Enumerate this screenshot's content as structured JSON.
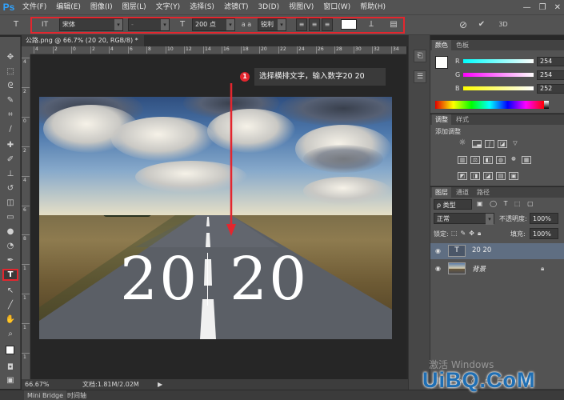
{
  "app": {
    "logo": "Ps",
    "menu": [
      "文件(F)",
      "编辑(E)",
      "图像(I)",
      "图层(L)",
      "文字(Y)",
      "选择(S)",
      "滤镜(T)",
      "3D(D)",
      "视图(V)",
      "窗口(W)",
      "帮助(H)"
    ],
    "window_controls": [
      "—",
      "❐",
      "✕"
    ]
  },
  "options_bar": {
    "tool_icon": "T",
    "orientation_icon": "IT",
    "font_family": "宋体",
    "font_style": "-",
    "font_size": "200 点",
    "aa_label": "a a",
    "aa_method": "锐利",
    "color_swatch": "#ffffff",
    "cancel_icon": "⊘",
    "commit_icon": "✔",
    "threed_label": "3D"
  },
  "document": {
    "tab_title": "公路.png @ 66.7% (20 20, RGB/8) *",
    "close_glyph": "×",
    "ruler_h_labels": [
      "4",
      "2",
      "0",
      "2",
      "4",
      "6",
      "8",
      "10",
      "12",
      "14",
      "16",
      "18",
      "20",
      "22",
      "24",
      "26",
      "28",
      "30",
      "32",
      "34"
    ],
    "ruler_v_labels": [
      "4",
      "2",
      "0",
      "2",
      "4",
      "6",
      "8",
      "1",
      "1",
      "1",
      "1"
    ],
    "canvas_text": "20 20",
    "canvas_text_left": "20",
    "canvas_text_right": "20"
  },
  "annotation": {
    "number": "1",
    "text": "选择横排文字，输入数字20 20"
  },
  "status_bar": {
    "zoom": "66.67%",
    "doc_info": "文档:1.81M/2.02M",
    "arrow": "▶"
  },
  "bottom_tabs": [
    "Mini Bridge",
    "时间轴"
  ],
  "color_panel": {
    "tabs": [
      "颜色",
      "色板"
    ],
    "r_label": "R",
    "g_label": "G",
    "b_label": "B",
    "r": "254",
    "g": "254",
    "b": "252"
  },
  "adjust_panel": {
    "tabs": [
      "调整",
      "样式"
    ],
    "add_label": "添加调整"
  },
  "layers_panel": {
    "tabs": [
      "图层",
      "通道",
      "路径"
    ],
    "filter_label": "ρ 类型",
    "blend_mode": "正常",
    "opacity_label": "不透明度:",
    "opacity": "100%",
    "lock_label": "锁定:",
    "fill_label": "填充:",
    "fill": "100%",
    "layers": [
      {
        "name": "20 20",
        "thumb": "T",
        "selected": true
      },
      {
        "name": "背景",
        "thumb": "",
        "selected": false
      }
    ]
  },
  "watermark": {
    "line1": "激活 Windows",
    "line2": "UiBQ.CoM"
  }
}
